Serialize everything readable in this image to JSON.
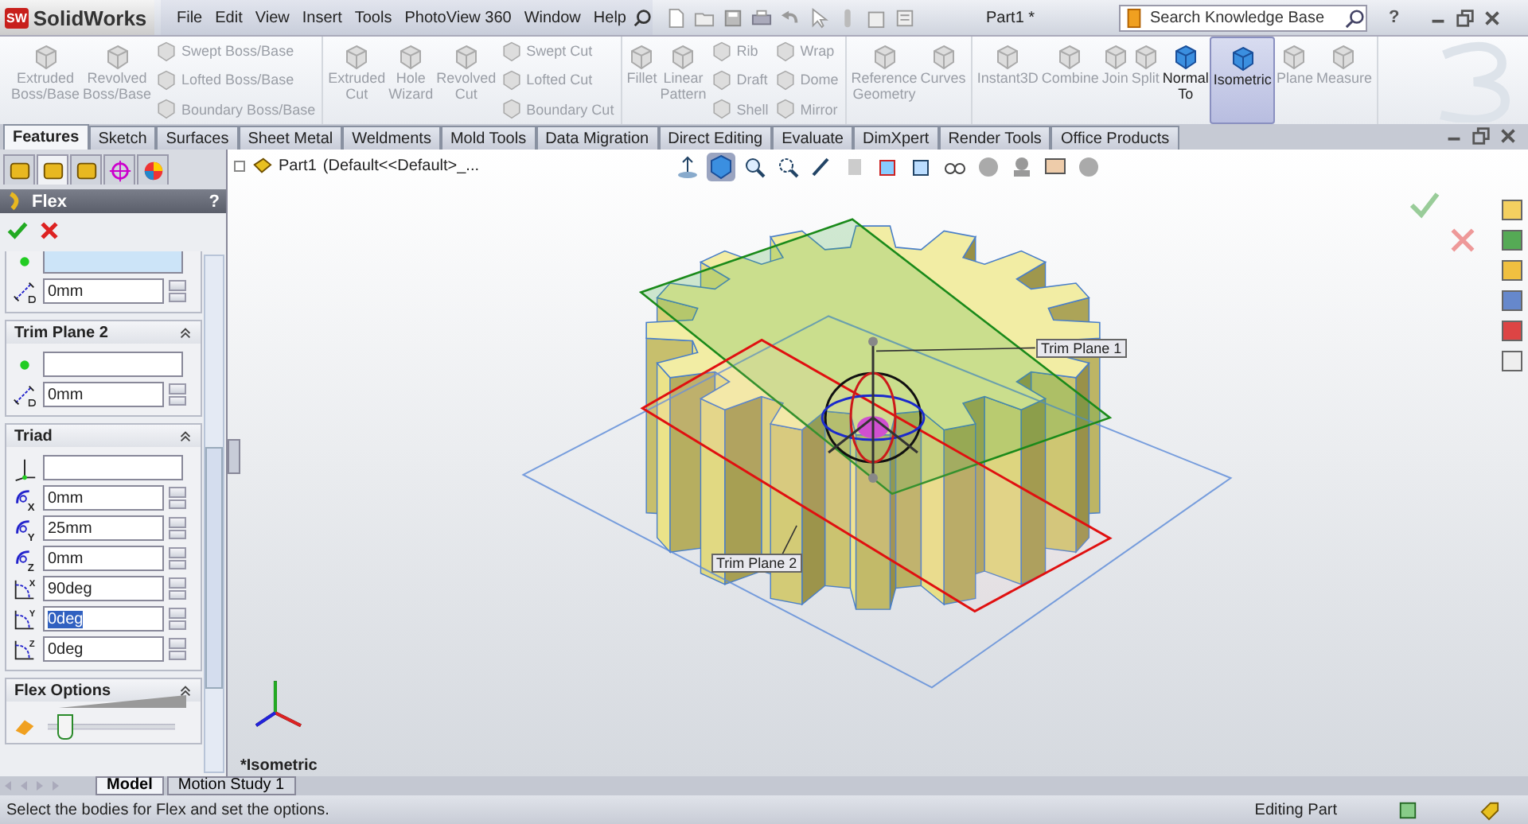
{
  "app": {
    "logo": "SW",
    "name": "SolidWorks"
  },
  "menu": [
    "File",
    "Edit",
    "View",
    "Insert",
    "Tools",
    "PhotoView 360",
    "Window",
    "Help"
  ],
  "document_title": "Part1 *",
  "search": {
    "placeholder": "Search Knowledge Base"
  },
  "help": "?",
  "ribbon": [
    {
      "sections": [
        {
          "kind": "large",
          "items": [
            {
              "label": "Extruded Boss/Base",
              "disabled": true,
              "selected": false
            },
            {
              "label": "Revolved Boss/Base",
              "disabled": true,
              "selected": false
            }
          ]
        },
        {
          "kind": "stack",
          "items": [
            {
              "label": "Swept Boss/Base",
              "disabled": true,
              "selected": false
            },
            {
              "label": "Lofted Boss/Base",
              "disabled": true,
              "selected": false
            },
            {
              "label": "Boundary Boss/Base",
              "disabled": true,
              "selected": false
            }
          ]
        }
      ]
    },
    {
      "sections": [
        {
          "kind": "large",
          "items": [
            {
              "label": "Extruded Cut",
              "disabled": true,
              "selected": false
            },
            {
              "label": "Hole Wizard",
              "disabled": true,
              "selected": false
            },
            {
              "label": "Revolved Cut",
              "disabled": true,
              "selected": false
            }
          ]
        },
        {
          "kind": "stack",
          "items": [
            {
              "label": "Swept Cut",
              "disabled": true,
              "selected": false
            },
            {
              "label": "Lofted Cut",
              "disabled": true,
              "selected": false
            },
            {
              "label": "Boundary Cut",
              "disabled": true,
              "selected": false
            }
          ]
        }
      ]
    },
    {
      "sections": [
        {
          "kind": "large",
          "items": [
            {
              "label": "Fillet",
              "disabled": true,
              "selected": false
            },
            {
              "label": "Linear Pattern",
              "disabled": true,
              "selected": false
            }
          ]
        },
        {
          "kind": "stack",
          "items": [
            {
              "label": "Rib",
              "disabled": true,
              "selected": false
            },
            {
              "label": "Draft",
              "disabled": true,
              "selected": false
            },
            {
              "label": "Shell",
              "disabled": true,
              "selected": false
            }
          ]
        },
        {
          "kind": "stack",
          "items": [
            {
              "label": "Wrap",
              "disabled": true,
              "selected": false
            },
            {
              "label": "Dome",
              "disabled": true,
              "selected": false
            },
            {
              "label": "Mirror",
              "disabled": true,
              "selected": false
            }
          ]
        }
      ]
    },
    {
      "sections": [
        {
          "kind": "large",
          "items": [
            {
              "label": "Reference Geometry",
              "disabled": true,
              "selected": false
            },
            {
              "label": "Curves",
              "disabled": true,
              "selected": false
            }
          ]
        }
      ]
    },
    {
      "sections": [
        {
          "kind": "large",
          "items": [
            {
              "label": "Instant3D",
              "disabled": true,
              "selected": false
            },
            {
              "label": "Combine",
              "disabled": true,
              "selected": false
            },
            {
              "label": "Join",
              "disabled": true,
              "selected": false
            },
            {
              "label": "Split",
              "disabled": true,
              "selected": false
            },
            {
              "label": "Normal To",
              "disabled": false,
              "selected": false
            },
            {
              "label": "Isometric",
              "disabled": false,
              "selected": true
            },
            {
              "label": "Plane",
              "disabled": true,
              "selected": false
            },
            {
              "label": "Measure",
              "disabled": true,
              "selected": false
            }
          ]
        }
      ]
    }
  ],
  "tabs": [
    {
      "label": "Features",
      "selected": true
    },
    {
      "label": "Sketch",
      "selected": false
    },
    {
      "label": "Surfaces",
      "selected": false
    },
    {
      "label": "Sheet Metal",
      "selected": false
    },
    {
      "label": "Weldments",
      "selected": false
    },
    {
      "label": "Mold Tools",
      "selected": false
    },
    {
      "label": "Data Migration",
      "selected": false
    },
    {
      "label": "Direct Editing",
      "selected": false
    },
    {
      "label": "Evaluate",
      "selected": false
    },
    {
      "label": "DimXpert",
      "selected": false
    },
    {
      "label": "Render Tools",
      "selected": false
    },
    {
      "label": "Office Products",
      "selected": false
    }
  ],
  "panel_tabs": [
    {
      "selected": false
    },
    {
      "selected": true
    },
    {
      "selected": false
    },
    {
      "selected": false
    },
    {
      "selected": false
    }
  ],
  "feature": {
    "title": "Flex",
    "help": "?"
  },
  "sections": [
    {
      "rows": [
        {
          "kind": "selection",
          "active": true
        },
        {
          "kind": "distance",
          "value": "0mm",
          "text_selected": false
        }
      ]
    },
    {
      "title": "Trim Plane 2",
      "expanded": true,
      "rows": [
        {
          "kind": "selection",
          "active": false
        },
        {
          "kind": "distance",
          "value": "0mm",
          "text_selected": false
        }
      ]
    },
    {
      "title": "Triad",
      "expanded": true,
      "rows": [
        {
          "kind": "triad-selection",
          "active": false
        },
        {
          "kind": "position",
          "axis": "X",
          "value": "0mm",
          "text_selected": false
        },
        {
          "kind": "position",
          "axis": "Y",
          "value": "25mm",
          "text_selected": false
        },
        {
          "kind": "position",
          "axis": "Z",
          "value": "0mm",
          "text_selected": false
        },
        {
          "kind": "rotation",
          "axis": "X",
          "value": "90deg",
          "text_selected": false
        },
        {
          "kind": "rotation",
          "axis": "Y",
          "value": "0deg",
          "text_selected": true
        },
        {
          "kind": "rotation",
          "axis": "Z",
          "value": "0deg",
          "text_selected": false
        }
      ]
    },
    {
      "title": "Flex Options",
      "expanded": true,
      "rows": [
        {
          "kind": "slider",
          "level": 0.12
        }
      ]
    }
  ],
  "viewport": {
    "part": "Part1",
    "configuration": "(Default<<Default>_...",
    "labels": [
      "Trim Plane 1",
      "Trim Plane 2"
    ],
    "view_name": "*Isometric"
  },
  "bottom_tabs": [
    {
      "label": "Model",
      "selected": true
    },
    {
      "label": "Motion Study 1",
      "selected": false
    }
  ],
  "status": {
    "message": "Select the bodies for Flex and set the options.",
    "mode": "Editing Part"
  }
}
